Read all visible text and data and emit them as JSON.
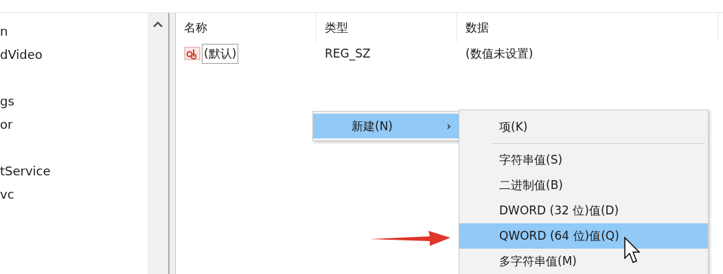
{
  "tree": {
    "items": [
      {
        "label": "n"
      },
      {
        "label": "dVideo"
      },
      {
        "label": "gs"
      },
      {
        "label": "or"
      },
      {
        "label": "tService"
      },
      {
        "label": "vc"
      }
    ]
  },
  "table": {
    "columns": [
      "名称",
      "类型",
      "数据"
    ],
    "rows": [
      {
        "cells": [
          "(默认)",
          "REG_SZ",
          "(数值未设置)"
        ],
        "focused": true
      }
    ]
  },
  "context_menu": {
    "items": [
      {
        "label": "新建(N)",
        "arrow": "›",
        "selected": true
      }
    ]
  },
  "submenu": {
    "items": [
      {
        "kind": "item",
        "label": "项(K)",
        "selected": false
      },
      {
        "kind": "separator"
      },
      {
        "kind": "item",
        "label": "字符串值(S)",
        "selected": false
      },
      {
        "kind": "item",
        "label": "二进制值(B)",
        "selected": false
      },
      {
        "kind": "item",
        "label": "DWORD (32 位)值(D)",
        "selected": false
      },
      {
        "kind": "item",
        "label": "QWORD (64 位)值(Q)",
        "selected": true
      },
      {
        "kind": "item",
        "label": "多字符串值(M)",
        "selected": false
      }
    ]
  }
}
